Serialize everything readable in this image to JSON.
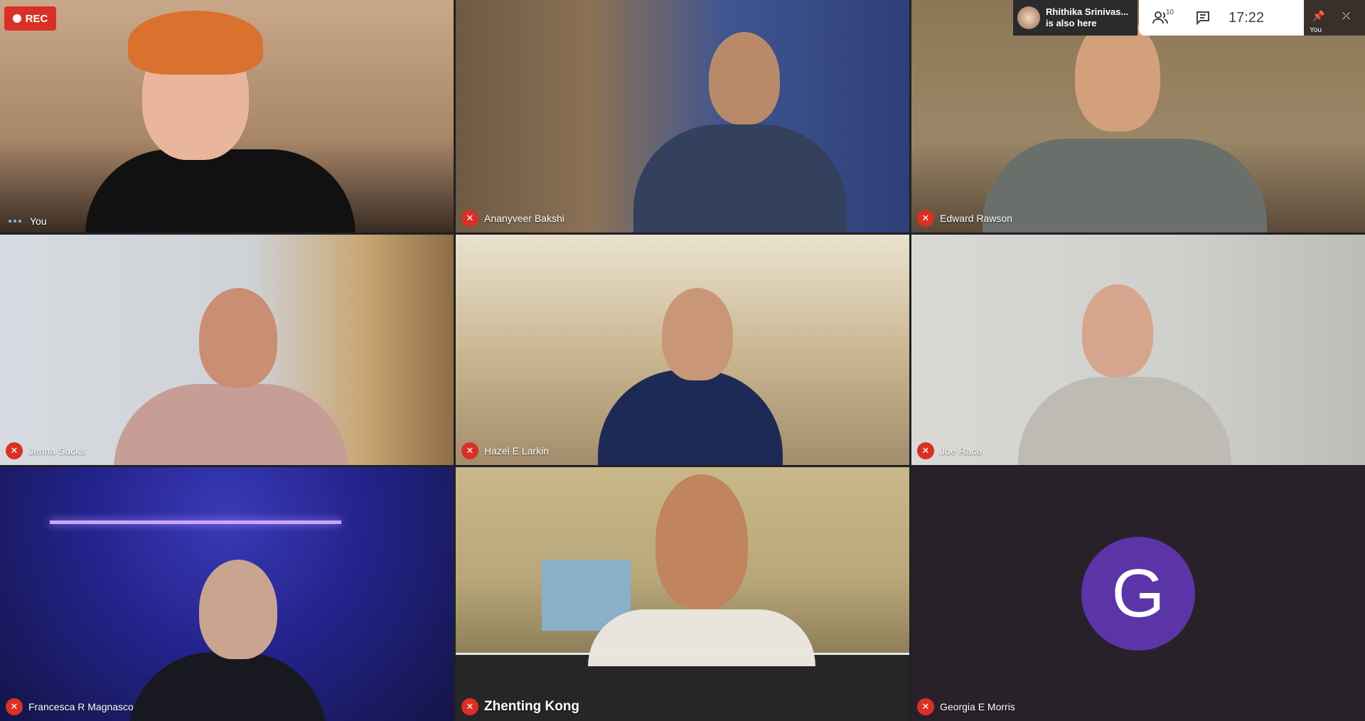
{
  "recording": {
    "label": "REC"
  },
  "notice": {
    "name": "Rhithika Srinivas...",
    "subtitle": "is also here"
  },
  "topbar": {
    "people_count": "10",
    "time": "17:22"
  },
  "selfview": {
    "label": "You"
  },
  "tiles": [
    {
      "name": "You",
      "muted": false
    },
    {
      "name": "Ananyveer Bakshi",
      "muted": true
    },
    {
      "name": "Edward Rawson",
      "muted": true
    },
    {
      "name": "Jenna Sacks",
      "muted": true
    },
    {
      "name": "Hazel E Larkin",
      "muted": true
    },
    {
      "name": "Joe Race",
      "muted": true
    },
    {
      "name": "Francesca R Magnasco",
      "muted": true
    },
    {
      "name": "Zhenting Kong",
      "muted": true
    },
    {
      "name": "Georgia E Morris",
      "muted": true,
      "avatar_letter": "G"
    }
  ],
  "colors": {
    "accent_red": "#d93025",
    "avatar_purple": "#5b35a8"
  }
}
